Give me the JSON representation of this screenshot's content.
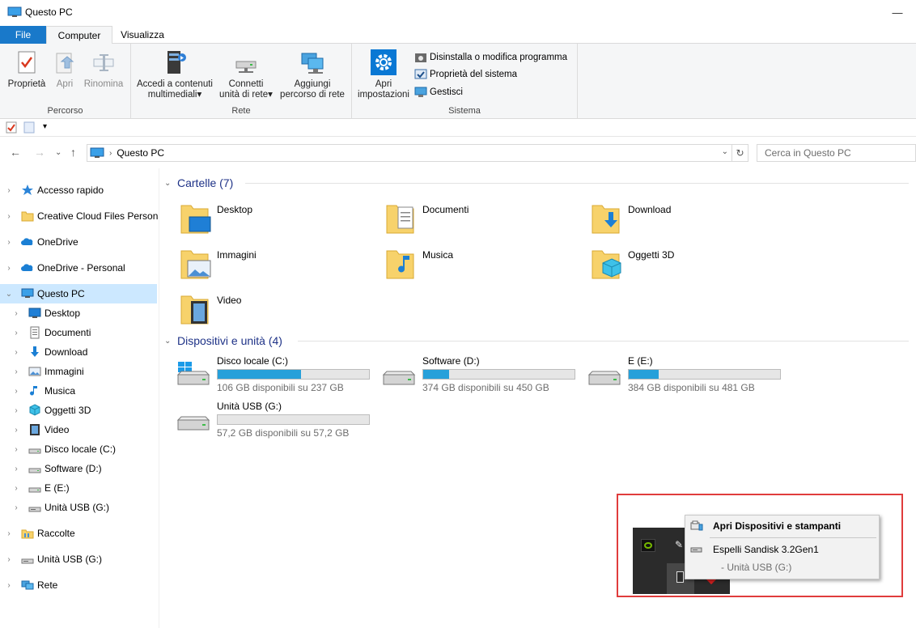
{
  "window": {
    "title": "Questo PC",
    "minimize_glyph": "—"
  },
  "ribbon_tabs": {
    "file": "File",
    "computer": "Computer",
    "view": "Visualizza"
  },
  "ribbon": {
    "percorso": {
      "name": "Percorso",
      "properties": "Proprietà",
      "open": "Apri",
      "rename": "Rinomina"
    },
    "rete": {
      "name": "Rete",
      "media_line1": "Accedi a contenuti",
      "media_line2": "multimediali",
      "map_line1": "Connetti",
      "map_line2": "unità di rete",
      "add_line1": "Aggiungi",
      "add_line2": "percorso di rete"
    },
    "sistema": {
      "name": "Sistema",
      "settings_line1": "Apri",
      "settings_line2": "impostazioni",
      "uninstall": "Disinstalla o modifica programma",
      "system_props": "Proprietà del sistema",
      "manage": "Gestisci"
    },
    "dropdown_glyph": "▾"
  },
  "address": {
    "location": "Questo PC",
    "search_placeholder": "Cerca in Questo PC",
    "separator": "›"
  },
  "navpane": {
    "items": [
      {
        "label": "Accesso rapido",
        "icon": "star-icon"
      },
      {
        "label": "Creative Cloud Files Personal",
        "icon": "folder-icon"
      },
      {
        "label": "OneDrive",
        "icon": "cloud-icon"
      },
      {
        "label": "OneDrive - Personal",
        "icon": "cloud-icon"
      },
      {
        "label": "Questo PC",
        "icon": "computer-icon"
      },
      {
        "label": "Desktop",
        "icon": "desktop-icon"
      },
      {
        "label": "Documenti",
        "icon": "documents-icon"
      },
      {
        "label": "Download",
        "icon": "download-icon"
      },
      {
        "label": "Immagini",
        "icon": "pictures-icon"
      },
      {
        "label": "Musica",
        "icon": "music-icon"
      },
      {
        "label": "Oggetti 3D",
        "icon": "cube-icon"
      },
      {
        "label": "Video",
        "icon": "video-icon"
      },
      {
        "label": "Disco locale (C:)",
        "icon": "drive-icon"
      },
      {
        "label": "Software (D:)",
        "icon": "drive-icon"
      },
      {
        "label": "E (E:)",
        "icon": "drive-icon"
      },
      {
        "label": "Unità USB (G:)",
        "icon": "usb-drive-icon"
      },
      {
        "label": "Raccolte",
        "icon": "libraries-icon"
      },
      {
        "label": "Unità USB (G:)",
        "icon": "usb-drive-icon"
      },
      {
        "label": "Rete",
        "icon": "network-icon"
      }
    ]
  },
  "folders_section": {
    "title": "Cartelle (7)",
    "items": [
      {
        "label": "Desktop"
      },
      {
        "label": "Documenti"
      },
      {
        "label": "Download"
      },
      {
        "label": "Immagini"
      },
      {
        "label": "Musica"
      },
      {
        "label": "Oggetti 3D"
      },
      {
        "label": "Video"
      }
    ]
  },
  "devices_section": {
    "title": "Dispositivi e unità (4)",
    "items": [
      {
        "label": "Disco locale (C:)",
        "info": "106 GB disponibili su 237 GB",
        "used_fraction": 0.55
      },
      {
        "label": "Software (D:)",
        "info": "374 GB disponibili su 450 GB",
        "used_fraction": 0.17
      },
      {
        "label": "E (E:)",
        "info": "384 GB disponibili su 481 GB",
        "used_fraction": 0.2
      },
      {
        "label": "Unità USB (G:)",
        "info": "57,2 GB disponibili su 57,2 GB",
        "used_fraction": 0.0
      }
    ]
  },
  "context_menu": {
    "open_devices": "Apri Dispositivi e stampanti",
    "eject": "Espelli Sandisk 3.2Gen1",
    "eject_sub": "-   Unità USB (G:)"
  },
  "colors": {
    "accent": "#1979ca",
    "selection": "#cce8ff",
    "bar_fill": "#26a0da",
    "highlight_border": "#e03c3c"
  }
}
